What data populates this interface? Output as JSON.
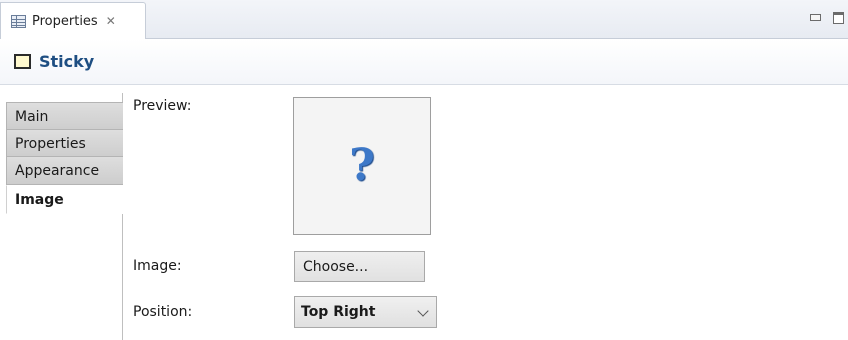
{
  "view": {
    "tab_label": "Properties",
    "close_glyph": "✕",
    "icons": {
      "tab": "properties-table-icon",
      "minimize": "minimize-icon",
      "maximize": "maximize-icon"
    }
  },
  "header": {
    "title": "Sticky",
    "icon": "sticky-note-icon",
    "title_color": "#1e4e82"
  },
  "sidebar": {
    "items": [
      {
        "label": "Main",
        "selected": false
      },
      {
        "label": "Properties",
        "selected": false
      },
      {
        "label": "Appearance",
        "selected": false
      },
      {
        "label": "Image",
        "selected": true
      }
    ]
  },
  "form": {
    "preview_label": "Preview:",
    "preview_placeholder_icon": "question-mark-icon",
    "preview_glyph": "?",
    "image_label": "Image:",
    "choose_button": "Choose...",
    "position_label": "Position:",
    "position_value": "Top Right"
  }
}
